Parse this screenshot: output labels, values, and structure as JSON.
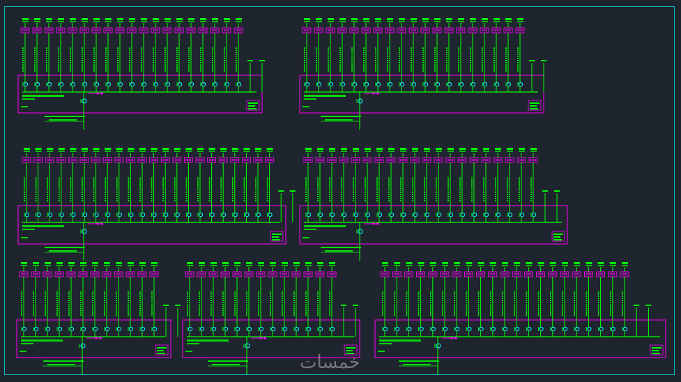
{
  "watermark": "خمسات",
  "colors": {
    "background": "#1f252e",
    "frame": "#00c0c0",
    "circuit": "#00ff00",
    "panel": "#ff00ff",
    "cyan": "#00ffff"
  },
  "panels": [
    {
      "id": "panel-1",
      "circuits": 19,
      "spares": 2
    },
    {
      "id": "panel-2",
      "circuits": 19,
      "spares": 2
    },
    {
      "id": "panel-3",
      "circuits": 22,
      "spares": 2
    },
    {
      "id": "panel-4",
      "circuits": 20,
      "spares": 2
    },
    {
      "id": "panel-5",
      "circuits": 12,
      "spares": 2
    },
    {
      "id": "panel-6",
      "circuits": 13,
      "spares": 2
    },
    {
      "id": "panel-7",
      "circuits": 21,
      "spares": 2
    }
  ]
}
